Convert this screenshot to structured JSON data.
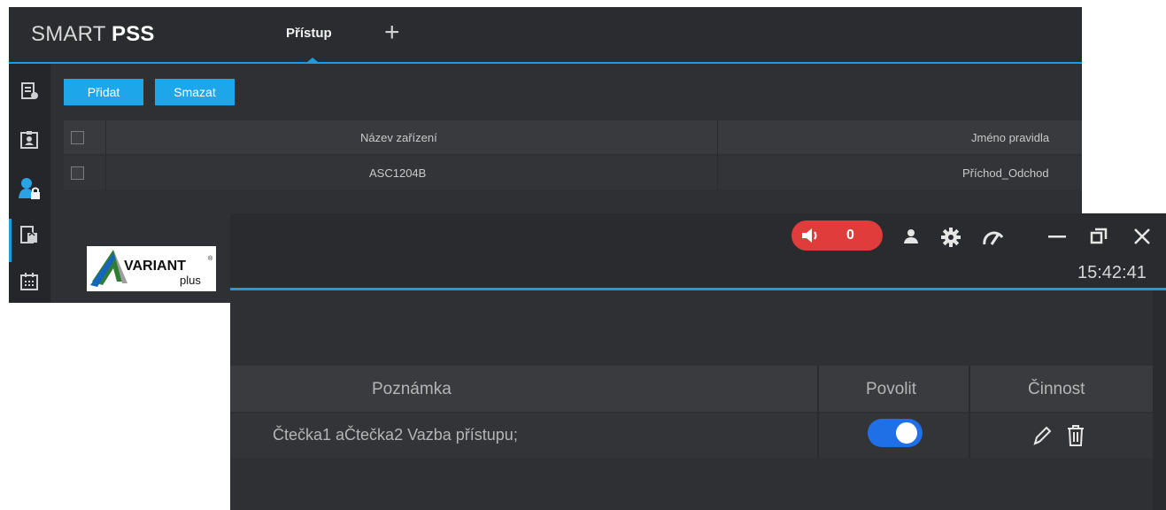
{
  "app": {
    "brand_prefix": "SMART",
    "brand_bold": "PSS"
  },
  "tabs": {
    "active_label": "Přístup",
    "add_symbol": "+"
  },
  "sidebar": {
    "icons": [
      "device-manager-icon",
      "person-card-icon",
      "access-user-lock-icon",
      "door-building-icon",
      "calendar-icon"
    ],
    "active_index": 2
  },
  "toolbar": {
    "add_label": "Přidat",
    "delete_label": "Smazat"
  },
  "rules_table": {
    "columns": [
      "Název zařízení",
      "Jméno pravidla"
    ],
    "rows": [
      {
        "device": "ASC1204B",
        "rule": "Příchod_Odchod"
      }
    ]
  },
  "logo": {
    "name": "VARIANT",
    "sub": "plus",
    "mark": "®"
  },
  "topbar": {
    "alarm_count": "0",
    "icons": [
      "speaker-alarm-icon",
      "user-icon",
      "gear-icon",
      "performance-gauge-icon",
      "minimize-icon",
      "restore-icon",
      "close-icon"
    ],
    "clock": "15:42:41"
  },
  "detail_table": {
    "columns": [
      "Poznámka",
      "Povolit",
      "Činnost"
    ],
    "rows": [
      {
        "note": "Čtečka1 aČtečka2 Vazba přístupu;",
        "enabled": true
      }
    ]
  },
  "colors": {
    "accent": "#1c9be0",
    "button": "#1ea6ea",
    "alarm": "#e03c3c",
    "toggle_on": "#1f6fe6"
  }
}
